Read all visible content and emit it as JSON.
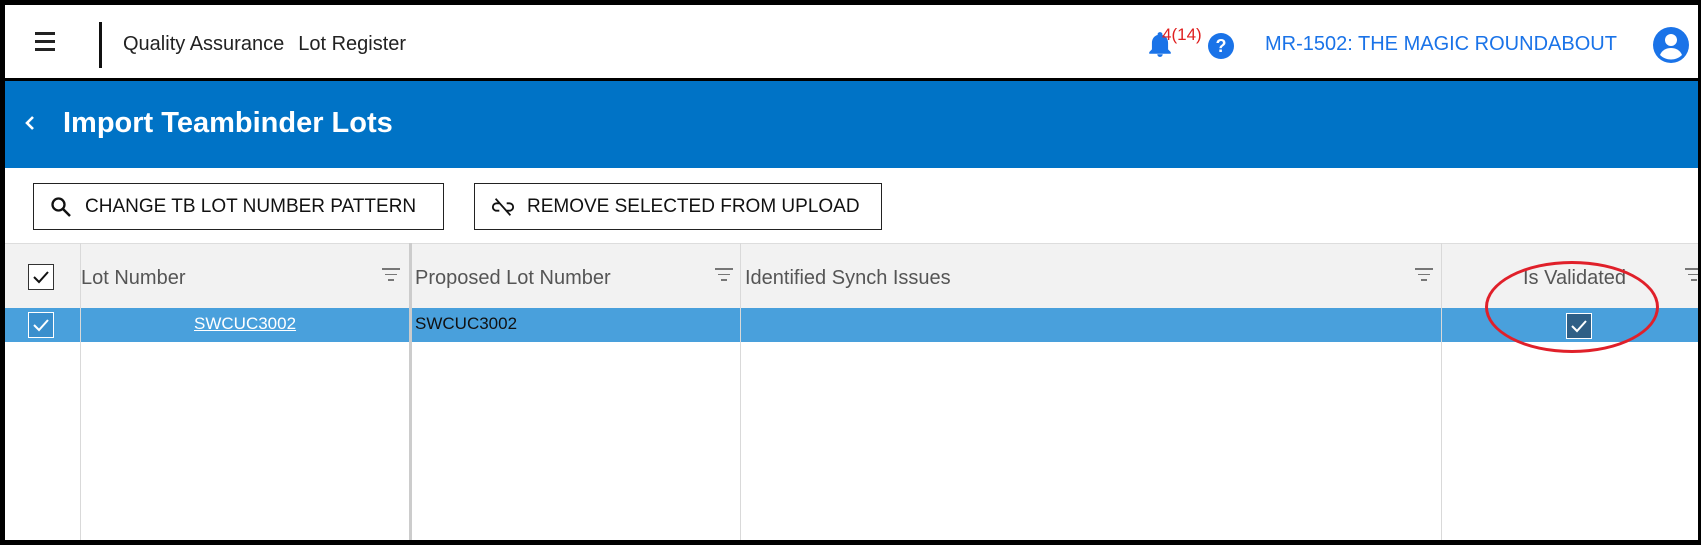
{
  "topbar": {
    "module": "Quality Assurance",
    "section": "Lot Register",
    "notifications": "4(14)",
    "help": "?",
    "project": "MR-1502: THE MAGIC ROUNDABOUT"
  },
  "header": {
    "title": "Import Teambinder Lots"
  },
  "toolbar": {
    "change_pattern_label": "CHANGE TB LOT NUMBER PATTERN",
    "remove_selected_label": "REMOVE SELECTED FROM UPLOAD"
  },
  "grid": {
    "columns": {
      "lot_number": "Lot Number",
      "proposed_lot_number": "Proposed Lot Number",
      "synch_issues": "Identified Synch Issues",
      "is_validated": "Is Validated"
    },
    "rows": [
      {
        "selected": true,
        "lot_number": "SWCUC3002",
        "proposed_lot_number": "SWCUC3002",
        "synch_issues": "",
        "is_validated": true
      }
    ]
  },
  "colors": {
    "header_blue": "#0073c6",
    "selected_row": "#49a0dc",
    "link_blue": "#1a73e8",
    "notification_red": "#e02020",
    "annotation_red": "#e0202a"
  },
  "icons": [
    "menu-icon",
    "bell-icon",
    "help-icon",
    "account-icon",
    "back-chevron-icon",
    "search-icon",
    "unlink-icon",
    "filter-icon",
    "checkmark-icon"
  ]
}
